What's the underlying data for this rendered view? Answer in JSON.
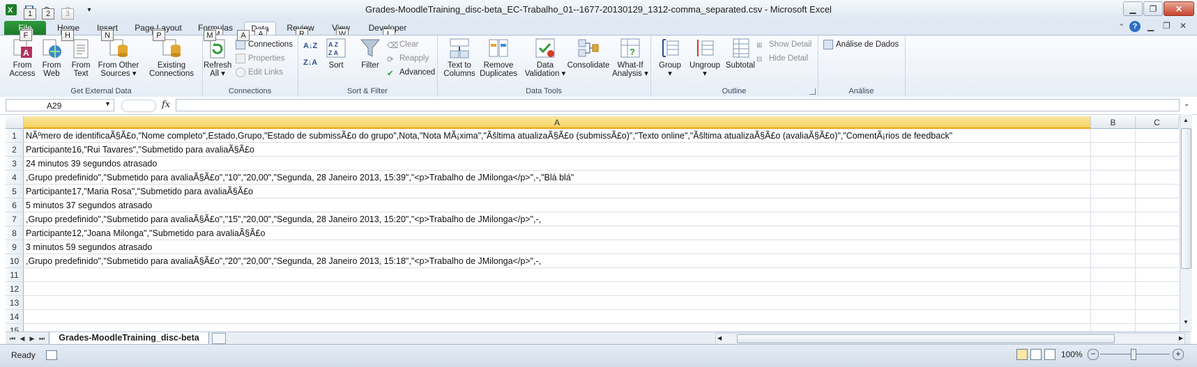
{
  "window": {
    "title": "Grades-MoodleTraining_disc-beta_EC-Trabalho_01--1677-20130129_1312-comma_separated.csv  -  Microsoft Excel",
    "qat_keytips": [
      "1",
      "2",
      "3"
    ]
  },
  "tabs": [
    {
      "label": "File",
      "keytip": "F"
    },
    {
      "label": "Home",
      "keytip": "H"
    },
    {
      "label": "Insert",
      "keytip": "N"
    },
    {
      "label": "Page Layout",
      "keytip": "P"
    },
    {
      "label": "Formulas",
      "keytip": "M"
    },
    {
      "label": "Data",
      "keytip": "A",
      "active": true
    },
    {
      "label": "Review",
      "keytip": "R"
    },
    {
      "label": "View",
      "keytip": "W"
    },
    {
      "label": "Developer",
      "keytip": "L"
    }
  ],
  "ribbon": {
    "get_external": {
      "label": "Get External Data",
      "buttons": [
        {
          "line1": "From",
          "line2": "Access"
        },
        {
          "line1": "From",
          "line2": "Web"
        },
        {
          "line1": "From",
          "line2": "Text"
        },
        {
          "line1": "From Other",
          "line2": "Sources ▾"
        },
        {
          "line1": "Existing",
          "line2": "Connections"
        }
      ]
    },
    "connections": {
      "label": "Connections",
      "refresh": {
        "line1": "Refresh",
        "line2": "All ▾"
      },
      "items": [
        "Connections",
        "Properties",
        "Edit Links"
      ]
    },
    "sort_filter": {
      "label": "Sort & Filter",
      "sort": "Sort",
      "filter": "Filter",
      "items": [
        "Clear",
        "Reapply",
        "Advanced"
      ]
    },
    "data_tools": {
      "label": "Data Tools",
      "buttons": [
        {
          "line1": "Text to",
          "line2": "Columns"
        },
        {
          "line1": "Remove",
          "line2": "Duplicates"
        },
        {
          "line1": "Data",
          "line2": "Validation ▾"
        },
        {
          "line1": "Consolidate",
          "line2": ""
        },
        {
          "line1": "What-If",
          "line2": "Analysis ▾"
        }
      ]
    },
    "outline": {
      "label": "Outline",
      "buttons": [
        {
          "line1": "Group",
          "line2": "▾"
        },
        {
          "line1": "Ungroup",
          "line2": "▾"
        },
        {
          "line1": "Subtotal",
          "line2": ""
        }
      ],
      "items": [
        "Show Detail",
        "Hide Detail"
      ]
    },
    "analise": {
      "label": "Análise",
      "item": "Análise de Dados"
    }
  },
  "formula_bar": {
    "name_box": "A29",
    "fx": "fx",
    "value": ""
  },
  "columns": [
    "A",
    "B",
    "C"
  ],
  "rows": [
    {
      "num": "1",
      "a": "NÃºmero de identificaÃ§Ã£o,\"Nome completo\",Estado,Grupo,\"Estado de submissÃ£o do grupo\",Nota,\"Nota MÃ¡xima\",\"Ãšltima atualizaÃ§Ã£o (submissÃ£o)\",\"Texto online\",\"Ãšltima atualizaÃ§Ã£o (avaliaÃ§Ã£o)\",\"ComentÃ¡rios de feedback\""
    },
    {
      "num": "2",
      "a": "Participante16,\"Rui Tavares\",\"Submetido para avaliaÃ§Ã£o"
    },
    {
      "num": "3",
      "a": "24 minutos 39 segundos atrasado"
    },
    {
      "num": "4",
      "a": ",Grupo predefinido\",\"Submetido para avaliaÃ§Ã£o\",\"10\",\"20,00\",\"Segunda, 28 Janeiro 2013, 15:39\",\"<p>Trabalho de JMilonga</p>\",-,\"Blá blá\""
    },
    {
      "num": "5",
      "a": "Participante17,\"Maria Rosa\",\"Submetido para avaliaÃ§Ã£o"
    },
    {
      "num": "6",
      "a": "5 minutos 37 segundos atrasado"
    },
    {
      "num": "7",
      "a": ",Grupo predefinido\",\"Submetido para avaliaÃ§Ã£o\",\"15\",\"20,00\",\"Segunda, 28 Janeiro 2013, 15:20\",\"<p>Trabalho de JMilonga</p>\",-,"
    },
    {
      "num": "8",
      "a": "Participante12,\"Joana Milonga\",\"Submetido para avaliaÃ§Ã£o"
    },
    {
      "num": "9",
      "a": "3 minutos 59 segundos atrasado"
    },
    {
      "num": "10",
      "a": ",Grupo predefinido\",\"Submetido para avaliaÃ§Ã£o\",\"20\",\"20,00\",\"Segunda, 28 Janeiro 2013, 15:18\",\"<p>Trabalho de JMilonga</p>\",-,"
    },
    {
      "num": "11",
      "a": ""
    },
    {
      "num": "12",
      "a": ""
    },
    {
      "num": "13",
      "a": ""
    },
    {
      "num": "14",
      "a": ""
    },
    {
      "num": "15",
      "a": ""
    }
  ],
  "sheet_tab": "Grades-MoodleTraining_disc-beta",
  "status": {
    "ready": "Ready",
    "zoom": "100%"
  },
  "colors": {
    "file_tab": "#1f7d2a",
    "selected_column_header": "#f6d25e"
  }
}
